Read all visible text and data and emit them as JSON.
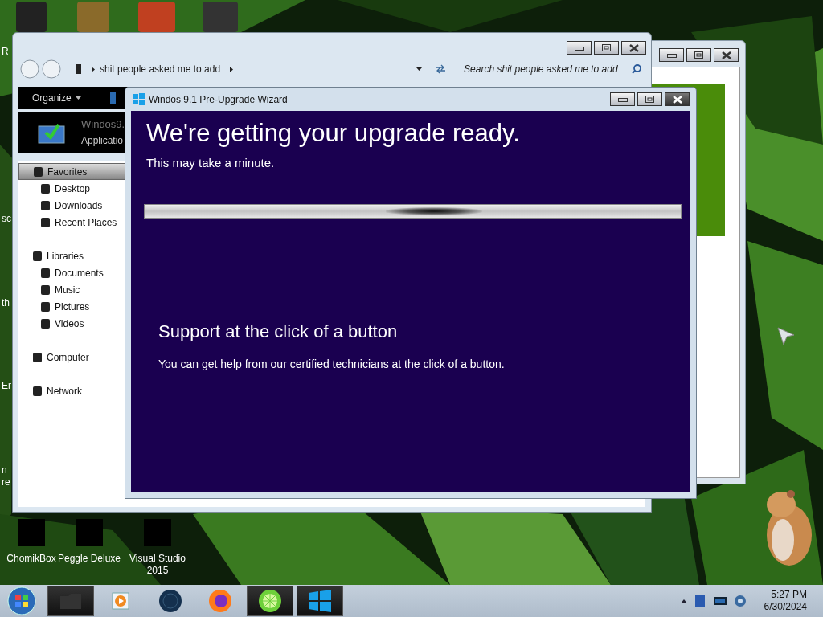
{
  "desktop": {
    "edge_labels": [
      "R",
      "sc",
      "th",
      "Er",
      "n",
      "re"
    ],
    "icons": [
      {
        "label": "ChomikBox"
      },
      {
        "label": "Peggle Deluxe"
      },
      {
        "label": "Visual Studio 2015"
      }
    ]
  },
  "explorer": {
    "breadcrumb": "shit people asked me to add",
    "search": {
      "placeholder": "Search shit people asked me to add"
    },
    "toolbar": [
      "Organize"
    ],
    "preview": {
      "title": "Windos9.",
      "subtitle": "Applicatio"
    },
    "sidebar": [
      {
        "label": "Favorites",
        "selected": true,
        "children": [
          {
            "label": "Desktop",
            "selected": false
          },
          {
            "label": "Downloads",
            "selected": false
          },
          {
            "label": "Recent Places",
            "selected": false
          }
        ]
      },
      {
        "label": "Libraries",
        "selected": false,
        "children": [
          {
            "label": "Documents",
            "selected": false
          },
          {
            "label": "Music",
            "selected": false
          },
          {
            "label": "Pictures",
            "selected": false
          },
          {
            "label": "Videos",
            "selected": false
          }
        ]
      },
      {
        "label": "Computer",
        "selected": false
      },
      {
        "label": "Network",
        "selected": false
      }
    ]
  },
  "wizard": {
    "title": "Windos 9.1 Pre-Upgrade Wizard",
    "heading": "We're getting your upgrade ready.",
    "subheading": "This may take a minute.",
    "section_title": "Support at the click of a button",
    "section_text": "You can get help from our certified technicians at the click of a button."
  },
  "taskbar": {
    "apps": [
      {
        "kind": "folder",
        "active": true
      },
      {
        "kind": "media",
        "active": false
      },
      {
        "kind": "globe",
        "active": false
      },
      {
        "kind": "browser",
        "active": false
      },
      {
        "kind": "lime",
        "active": true
      },
      {
        "kind": "windows",
        "active": true
      }
    ],
    "clock": {
      "time": "5:27 PM",
      "date": "6/30/2024"
    }
  }
}
